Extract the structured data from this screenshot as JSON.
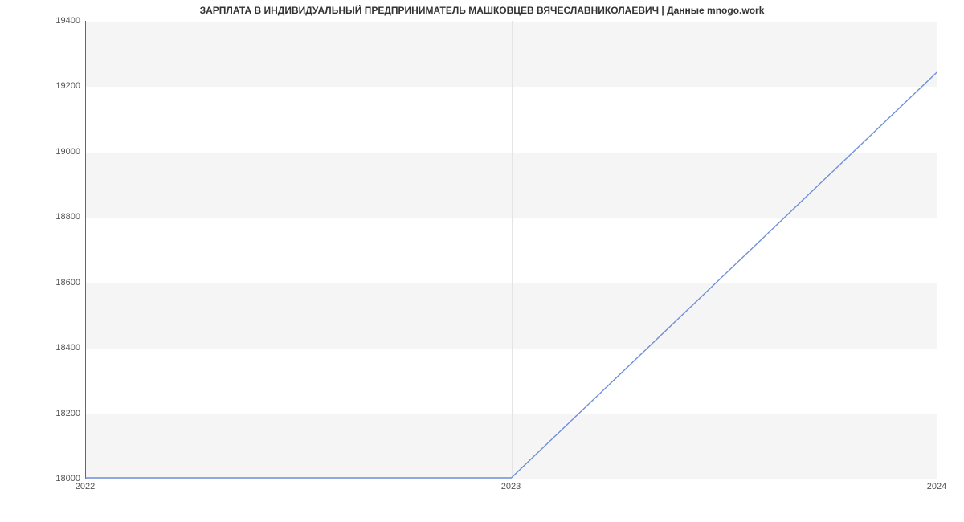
{
  "chart_data": {
    "type": "line",
    "title": "ЗАРПЛАТА В ИНДИВИДУАЛЬНЫЙ ПРЕДПРИНИМАТЕЛЬ МАШКОВЦЕВ ВЯЧЕСЛАВНИКОЛАЕВИЧ | Данные mnogo.work",
    "x": [
      2022,
      2023,
      2024
    ],
    "values": [
      18000,
      18000,
      19242
    ],
    "xlabel": "",
    "ylabel": "",
    "xticks": [
      2022,
      2023,
      2024
    ],
    "yticks": [
      18000,
      18200,
      18400,
      18600,
      18800,
      19000,
      19200,
      19400
    ],
    "xlim": [
      2022,
      2024
    ],
    "ylim": [
      18000,
      19400
    ],
    "line_color": "#6f8fd8"
  }
}
